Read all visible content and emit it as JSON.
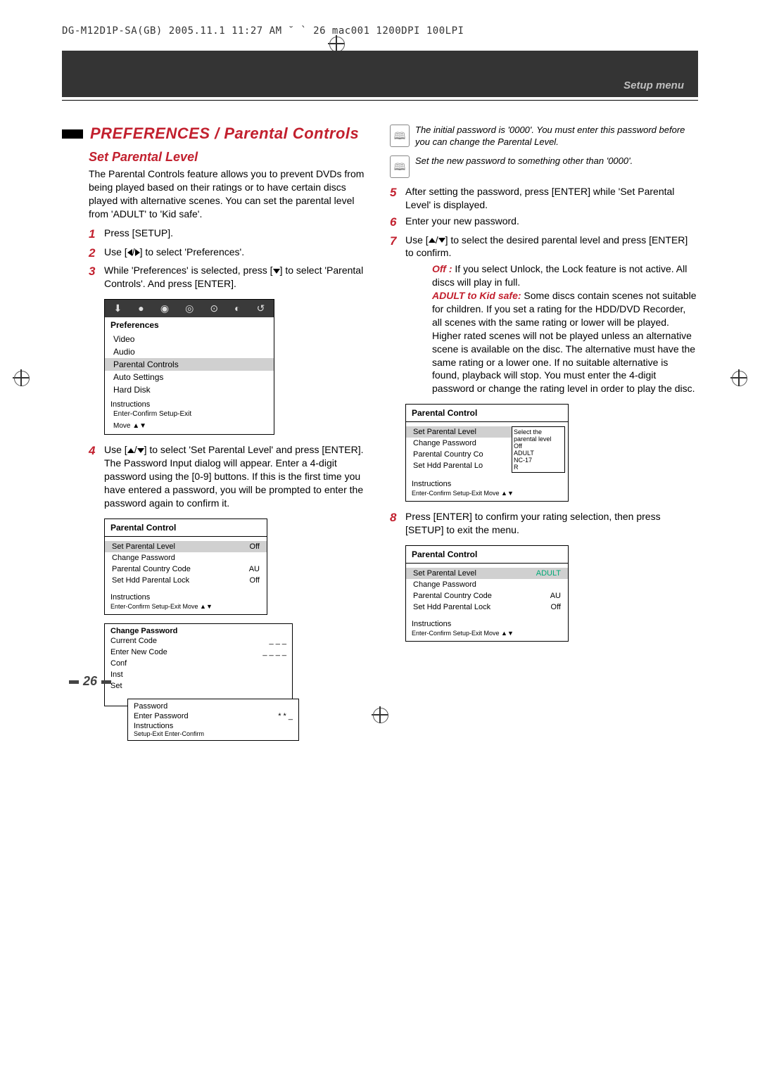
{
  "header_line": "DG-M12D1P-SA(GB)  2005.11.1 11:27 AM  ˘ ` 26   mac001  1200DPI 100LPI",
  "setup_menu": "Setup menu",
  "h1": "PREFERENCES /  Parental Controls",
  "h2": "Set Parental Level",
  "intro": "The Parental Controls feature allows you to prevent DVDs from being played based on their ratings or to have certain discs played with alternative scenes. You can set the parental level from 'ADULT' to 'Kid safe'.",
  "s1": "Press [SETUP].",
  "s2a": "Use [",
  "s2b": "] to select 'Preferences'.",
  "s3a": "While 'Preferences' is selected, press [",
  "s3b": "] to select 'Parental Controls'. And press [ENTER].",
  "osd": {
    "title": "Preferences",
    "i1": "Video",
    "i2": "Audio",
    "i3": "Parental Controls",
    "i4": "Auto Settings",
    "i5": "Hard Disk",
    "ins": "Instructions",
    "sub": "Enter-Confirm  Setup-Exit",
    "mv": "Move ▲▼"
  },
  "s4a": "Use [",
  "s4b": "] to select 'Set Parental Level' and press [ENTER].  The Password Input dialog will appear. Enter a 4-digit password using the [0-9] buttons. If this is the first time you have entered a password, you will be prompted to enter the password again to confirm it.",
  "pc1": {
    "t": "Parental Control",
    "a": "Set Parental Level",
    "av": "Off",
    "b": "Change Password",
    "c": "Parental Country Code",
    "cv": "AU",
    "d": "Set Hdd Parental Lock",
    "dv": "Off",
    "ins": "Instructions",
    "sb": "Enter-Confirm  Setup-Exit  Move ▲▼"
  },
  "cp": {
    "t": "Change Password",
    "a": "Current Code",
    "av": "_ _ _",
    "b": "Enter New Code",
    "bv": "_ _ _ _",
    "c": "Conf",
    "d": "Inst",
    "e": "Set",
    "pw": "Password",
    "ep": "Enter Password",
    "epv": "* *  _",
    "ins": "Instructions",
    "sb": "Setup-Exit  Enter-Confirm"
  },
  "n1": "The initial password is '0000'. You must enter this password before you can change the Parental Level.",
  "n2": "Set the new password to something other than '0000'.",
  "s5": "After setting the password, press [ENTER] while 'Set Parental Level' is displayed.",
  "s6": "Enter your new password.",
  "s7a": "Use [",
  "s7b": "] to select the desired parental level and press [ENTER] to confirm.",
  "off_l": "Off : ",
  "off": "If you select Unlock, the Lock feature is not active. All discs will play in full.",
  "ak_l": "ADULT to Kid safe: ",
  "ak": "Some discs contain scenes not suitable for children. If you set a rating for the HDD/DVD Recorder, all scenes with the same rating or lower will be played. Higher rated scenes will not be played unless an alternative scene is available on the disc. The alternative must have the same rating or a lower one. If no suitable alternative is found, playback will stop. You must enter the 4-digit password or change the rating level in order to play the disc.",
  "pc2": {
    "t": "Parental Control",
    "a": "Set Parental Level",
    "b": "Change Password",
    "c": "Parental Country Co",
    "d": "Set Hdd Parental Lo",
    "side_t": "Select the",
    "side_t2": "parental level",
    "o1": "Off",
    "o2": "ADULT",
    "o3": "NC-17",
    "o4": "R",
    "ins": "Instructions",
    "sb": "Enter-Confirm  Setup-Exit  Move ▲▼"
  },
  "s8": "Press [ENTER] to confirm your rating selection, then press [SETUP] to exit the menu.",
  "pc3": {
    "t": "Parental Control",
    "a": "Set Parental Level",
    "av": "ADULT",
    "b": "Change Password",
    "c": "Parental Country Code",
    "cv": "AU",
    "d": "Set Hdd Parental Lock",
    "dv": "Off",
    "ins": "Instructions",
    "sb": "Enter-Confirm  Setup-Exit  Move ▲▼"
  },
  "page": "26"
}
